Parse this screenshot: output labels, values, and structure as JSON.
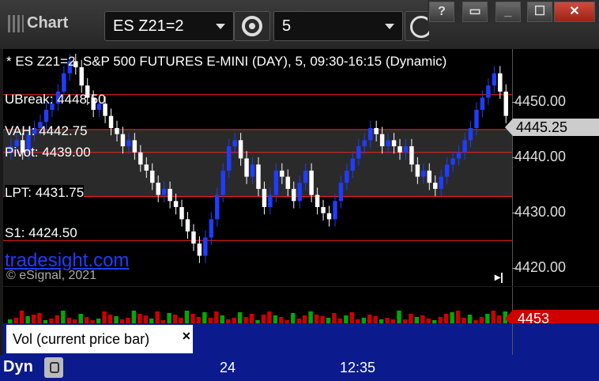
{
  "toolbar": {
    "app_title": "Chart",
    "symbol": "ES Z21=2",
    "interval": "5",
    "window_buttons": [
      "?",
      "▭",
      "_",
      "☐",
      "✕"
    ]
  },
  "chart": {
    "header": "* ES Z21=2, S&P 500 FUTURES E-MINI (DAY), 5, 09:30-16:15 (Dynamic)",
    "level_labels": {
      "ubreak": "UBreak: 4448.50",
      "vah": "VAH: 4442.75",
      "pivot": "Pivot: 4439.00",
      "lpt": "LPT: 4431.75",
      "s1": "S1: 4424.50"
    },
    "watermark": "tradesight.com",
    "copyright": "© eSignal, 2021",
    "colors": {
      "up": "#1f3cff",
      "down": "#ffffff",
      "seq": "#00aa00",
      "count": "#ff00ff",
      "level_red": "#ff2020"
    }
  },
  "price_axis": {
    "ticks": [
      "4450.00",
      "4440.00",
      "4430.00",
      "4420.00"
    ],
    "current_price": "4445.25"
  },
  "volume": {
    "last_value": "4453",
    "study_label": "Vol (current price bar)"
  },
  "time_axis": {
    "mode": "Dyn",
    "labels": [
      "24",
      "12:35"
    ]
  },
  "chart_data": {
    "type": "candlestick",
    "ylim": [
      4417,
      4456
    ],
    "levels": [
      {
        "name": "UBreak",
        "value": 4448.5
      },
      {
        "name": "VAH",
        "value": 4442.75
      },
      {
        "name": "Pivot",
        "value": 4439.0
      },
      {
        "name": "LPT",
        "value": 4431.75
      },
      {
        "name": "S1",
        "value": 4424.5
      }
    ],
    "closes": [
      4440,
      4441,
      4439,
      4442,
      4443,
      4444,
      4446,
      4447,
      4449,
      4452,
      4454,
      4453,
      4450,
      4448,
      4446,
      4447,
      4445,
      4443,
      4442,
      4440,
      4441,
      4439,
      4437,
      4436,
      4434,
      4432,
      4433,
      4431,
      4430,
      4428,
      4426,
      4424,
      4422,
      4425,
      4428,
      4432,
      4436,
      4440,
      4441,
      4438,
      4435,
      4437,
      4433,
      4430,
      4432,
      4436,
      4435,
      4433,
      4431,
      4434,
      4436,
      4432,
      4430,
      4429,
      4428,
      4431,
      4434,
      4436,
      4438,
      4440,
      4441,
      4443,
      4442,
      4440,
      4441,
      4440,
      4439,
      4440,
      4437,
      4435,
      4436,
      4434,
      4433,
      4435,
      4437,
      4438,
      4439,
      4441,
      4443,
      4446,
      4448,
      4450,
      4452,
      4449,
      4445
    ]
  }
}
